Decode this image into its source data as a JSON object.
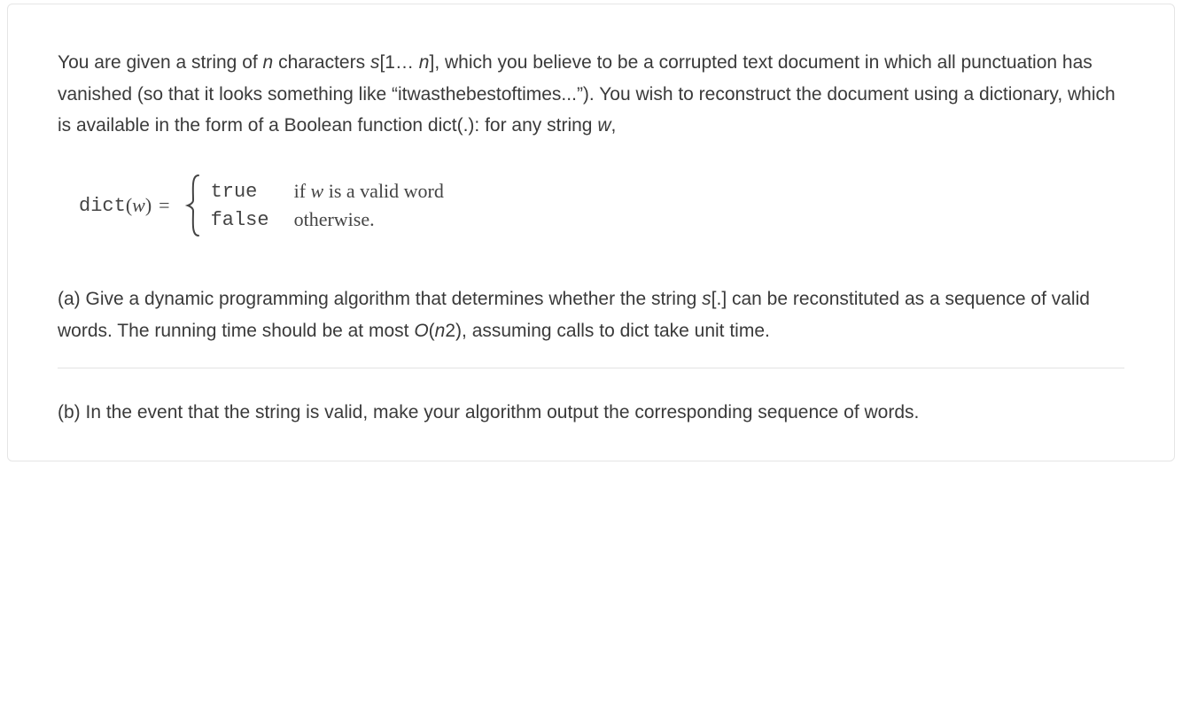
{
  "intro": {
    "segments": [
      {
        "text": "You are given a string of ",
        "italic": false
      },
      {
        "text": "n ",
        "italic": true
      },
      {
        "text": "characters ",
        "italic": false
      },
      {
        "text": "s",
        "italic": true
      },
      {
        "text": "[1… ",
        "italic": false
      },
      {
        "text": "n",
        "italic": true
      },
      {
        "text": "], which you believe to be a corrupted text document in which all punctuation has vanished (so that it looks something like “itwasthebestoftimes...”). You wish to reconstruct the document using a dictionary, which is available in the form of a Boolean function dict(.): for any string ",
        "italic": false
      },
      {
        "text": "w",
        "italic": true
      },
      {
        "text": ",",
        "italic": false
      }
    ]
  },
  "formula": {
    "lhs_fn": "dict",
    "lhs_open": "(",
    "lhs_var": "w",
    "lhs_close": ")",
    "lhs_eq": "=",
    "cases": [
      {
        "key": "true",
        "desc_segments": [
          {
            "text": "if ",
            "italic": false
          },
          {
            "text": "w",
            "italic": true
          },
          {
            "text": " is a valid word",
            "italic": false
          }
        ]
      },
      {
        "key": "false",
        "desc_segments": [
          {
            "text": "otherwise.",
            "italic": false
          }
        ]
      }
    ]
  },
  "partA": {
    "segments": [
      {
        "text": "(a) Give a dynamic programming algorithm that determines whether the string ",
        "italic": false
      },
      {
        "text": "s",
        "italic": true
      },
      {
        "text": "[.] can be reconstituted as a sequence of valid words. The running time should be at most ",
        "italic": false
      },
      {
        "text": "O",
        "italic": true
      },
      {
        "text": "(",
        "italic": false
      },
      {
        "text": "n",
        "italic": true
      },
      {
        "text": "2), assuming calls to dict take unit time.",
        "italic": false
      }
    ]
  },
  "partB": {
    "segments": [
      {
        "text": "(b) In the event that the string is valid, make your algorithm output the corresponding sequence of words.",
        "italic": false
      }
    ]
  }
}
